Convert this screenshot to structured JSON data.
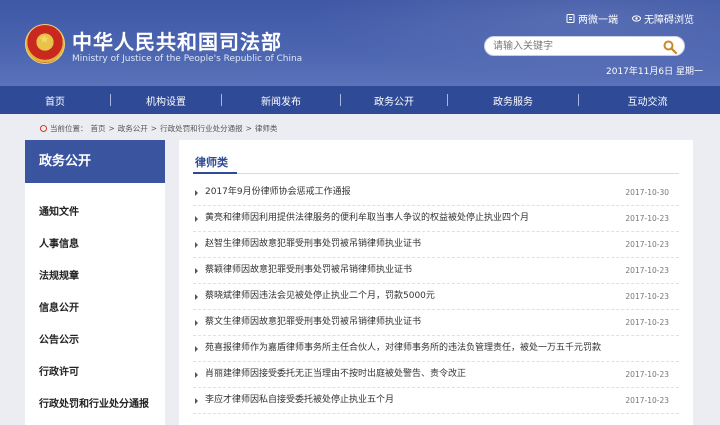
{
  "header": {
    "title": "中华人民共和国司法部",
    "subtitle": "Ministry of Justice of the People's Republic of China",
    "links": [
      {
        "label": "两微一端",
        "icon": "mobile-icon"
      },
      {
        "label": "无障碍浏览",
        "icon": "eye-icon"
      }
    ],
    "date": "2017年11月6日 星期一"
  },
  "search": {
    "placeholder": "请输入关键字",
    "icon": "magnifier-icon"
  },
  "nav": [
    "首页",
    "机构设置",
    "新闻发布",
    "政务公开",
    "政务服务",
    "互动交流"
  ],
  "breadcrumb": {
    "prefix": "当前位置：",
    "items": [
      "首页",
      "政务公开",
      "行政处罚和行业处分通报",
      "律师类"
    ],
    "separator": ">"
  },
  "sidebar": {
    "title": "政务公开",
    "items": [
      "通知文件",
      "人事信息",
      "法规规章",
      "信息公开",
      "公告公示",
      "行政许可",
      "行政处罚和行业处分通报"
    ]
  },
  "main": {
    "title": "律师类",
    "news": [
      {
        "title": "2017年9月份律师协会惩戒工作通报",
        "date": "2017-10-30"
      },
      {
        "title": "黄亮和律师因利用提供法律服务的便利牟取当事人争议的权益被处停止执业四个月",
        "date": "2017-10-23"
      },
      {
        "title": "赵智生律师因故意犯罪受刑事处罚被吊销律师执业证书",
        "date": "2017-10-23"
      },
      {
        "title": "蔡颖律师因故意犯罪受刑事处罚被吊销律师执业证书",
        "date": "2017-10-23"
      },
      {
        "title": "蔡晓斌律师因违法会见被处停止执业二个月，罚款5000元",
        "date": "2017-10-23"
      },
      {
        "title": "蔡文生律师因故意犯罪受刑事处罚被吊销律师执业证书",
        "date": "2017-10-23"
      },
      {
        "title": "苑喜报律师作为嘉盾律师事务所主任合伙人，对律师事务所的违法负管理责任，被处一万五千元罚款",
        "date": ""
      },
      {
        "title": "肖丽建律师因接受委托无正当理由不按时出庭被处警告、责令改正",
        "date": "2017-10-23"
      },
      {
        "title": "李应才律师因私自接受委托被处停止执业五个月",
        "date": "2017-10-23"
      }
    ]
  },
  "colors": {
    "brand": "#3f58a6",
    "nav": "#2f4a96"
  }
}
